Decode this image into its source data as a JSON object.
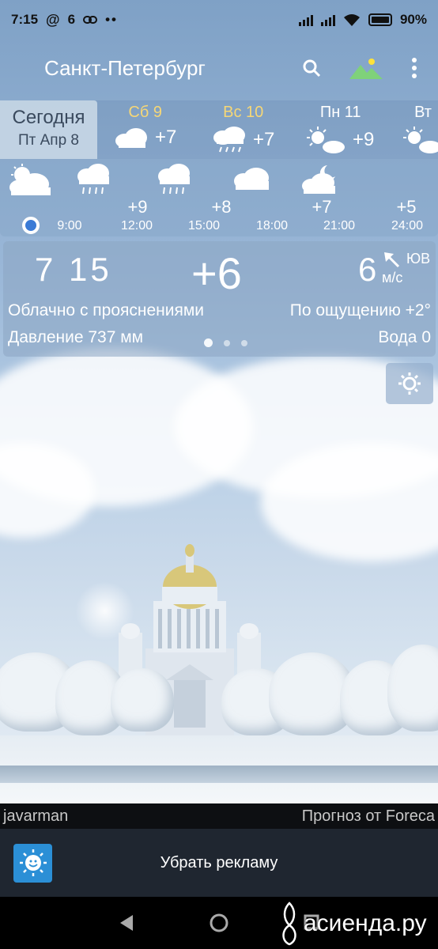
{
  "status_bar": {
    "time": "7:15",
    "notif_temp": "6",
    "battery": "90%"
  },
  "app_bar": {
    "city": "Санкт-Петербург",
    "icons": [
      "search-icon",
      "landscape-icon",
      "more-vert-icon"
    ]
  },
  "days": {
    "today": {
      "label": "Сегодня",
      "date": "Пт Апр 8"
    },
    "items": [
      {
        "label": "Сб 9",
        "temp": "+7",
        "icon": "cloudy-icon",
        "label_color": "#f6d776"
      },
      {
        "label": "Вс 10",
        "temp": "+7",
        "icon": "rain-icon",
        "label_color": "#f6d776"
      },
      {
        "label": "Пн 11",
        "temp": "+9",
        "icon": "partly-sunny-icon",
        "label_color": "#ffffff"
      },
      {
        "label": "Вт",
        "temp": "",
        "icon": "partly-sunny-icon",
        "label_color": "#ffffff"
      }
    ]
  },
  "hourly": {
    "items": [
      {
        "time": "9:00",
        "temp": "",
        "icon": "partly-cloudy-icon"
      },
      {
        "time": "12:00",
        "temp": "+9",
        "icon": "rain-icon"
      },
      {
        "time": "15:00",
        "temp": "+8",
        "icon": "rain-icon"
      },
      {
        "time": "18:00",
        "temp": "",
        "icon": "cloud-icon"
      },
      {
        "time": "21:00",
        "temp": "+7",
        "icon": "night-cloud-icon"
      },
      {
        "time": "24:00",
        "temp": "+5",
        "icon": ""
      }
    ]
  },
  "current": {
    "time": "7 15",
    "temp": "+6",
    "wind_speed": "6",
    "wind_dir": "ЮВ",
    "wind_unit": "м/с",
    "condition": "Облачно с прояснениями",
    "feels_like": "По ощущению +2°",
    "pressure": "Давление 737 мм",
    "water": "Вода 0"
  },
  "credits": {
    "author": "javarman",
    "provider": "Прогноз от Foreca"
  },
  "ad": {
    "label": "Убрать рекламу"
  },
  "watermark": {
    "text": "асиенда.ру"
  },
  "colors": {
    "accent_yellow": "#f6d776",
    "card_bg": "#8ca5c3",
    "ad_bg": "#1f2630"
  }
}
